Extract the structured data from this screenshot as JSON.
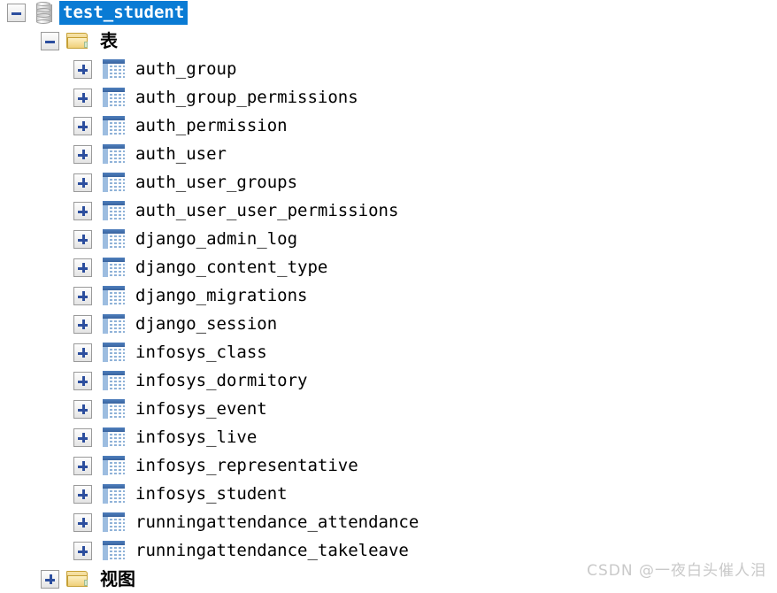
{
  "root": {
    "expander": "minus-expander",
    "icon": "database-icon",
    "label": "test_student",
    "selected": true
  },
  "tables_folder": {
    "expander": "minus-expander",
    "icon": "open-folder-icon",
    "label": "表"
  },
  "views_folder": {
    "expander": "plus-expander",
    "icon": "open-folder-icon",
    "label": "视图"
  },
  "tables": [
    {
      "label": "auth_group"
    },
    {
      "label": "auth_group_permissions"
    },
    {
      "label": "auth_permission"
    },
    {
      "label": "auth_user"
    },
    {
      "label": "auth_user_groups"
    },
    {
      "label": "auth_user_user_permissions"
    },
    {
      "label": "django_admin_log"
    },
    {
      "label": "django_content_type"
    },
    {
      "label": "django_migrations"
    },
    {
      "label": "django_session"
    },
    {
      "label": "infosys_class"
    },
    {
      "label": "infosys_dormitory"
    },
    {
      "label": "infosys_event"
    },
    {
      "label": "infosys_live"
    },
    {
      "label": "infosys_representative"
    },
    {
      "label": "infosys_student"
    },
    {
      "label": "runningattendance_attendance"
    },
    {
      "label": "runningattendance_takeleave"
    }
  ],
  "watermark": {
    "text": "CSDN @一夜白头催人泪"
  },
  "colors": {
    "selection_blue": "#0a7bd4",
    "table_icon_header": "#39649f",
    "folder_yellow": "#e8c86f",
    "expander_glyph": "#2c4e9e",
    "background": "#ffffff",
    "watermark_gray": "#c9c9c9"
  }
}
